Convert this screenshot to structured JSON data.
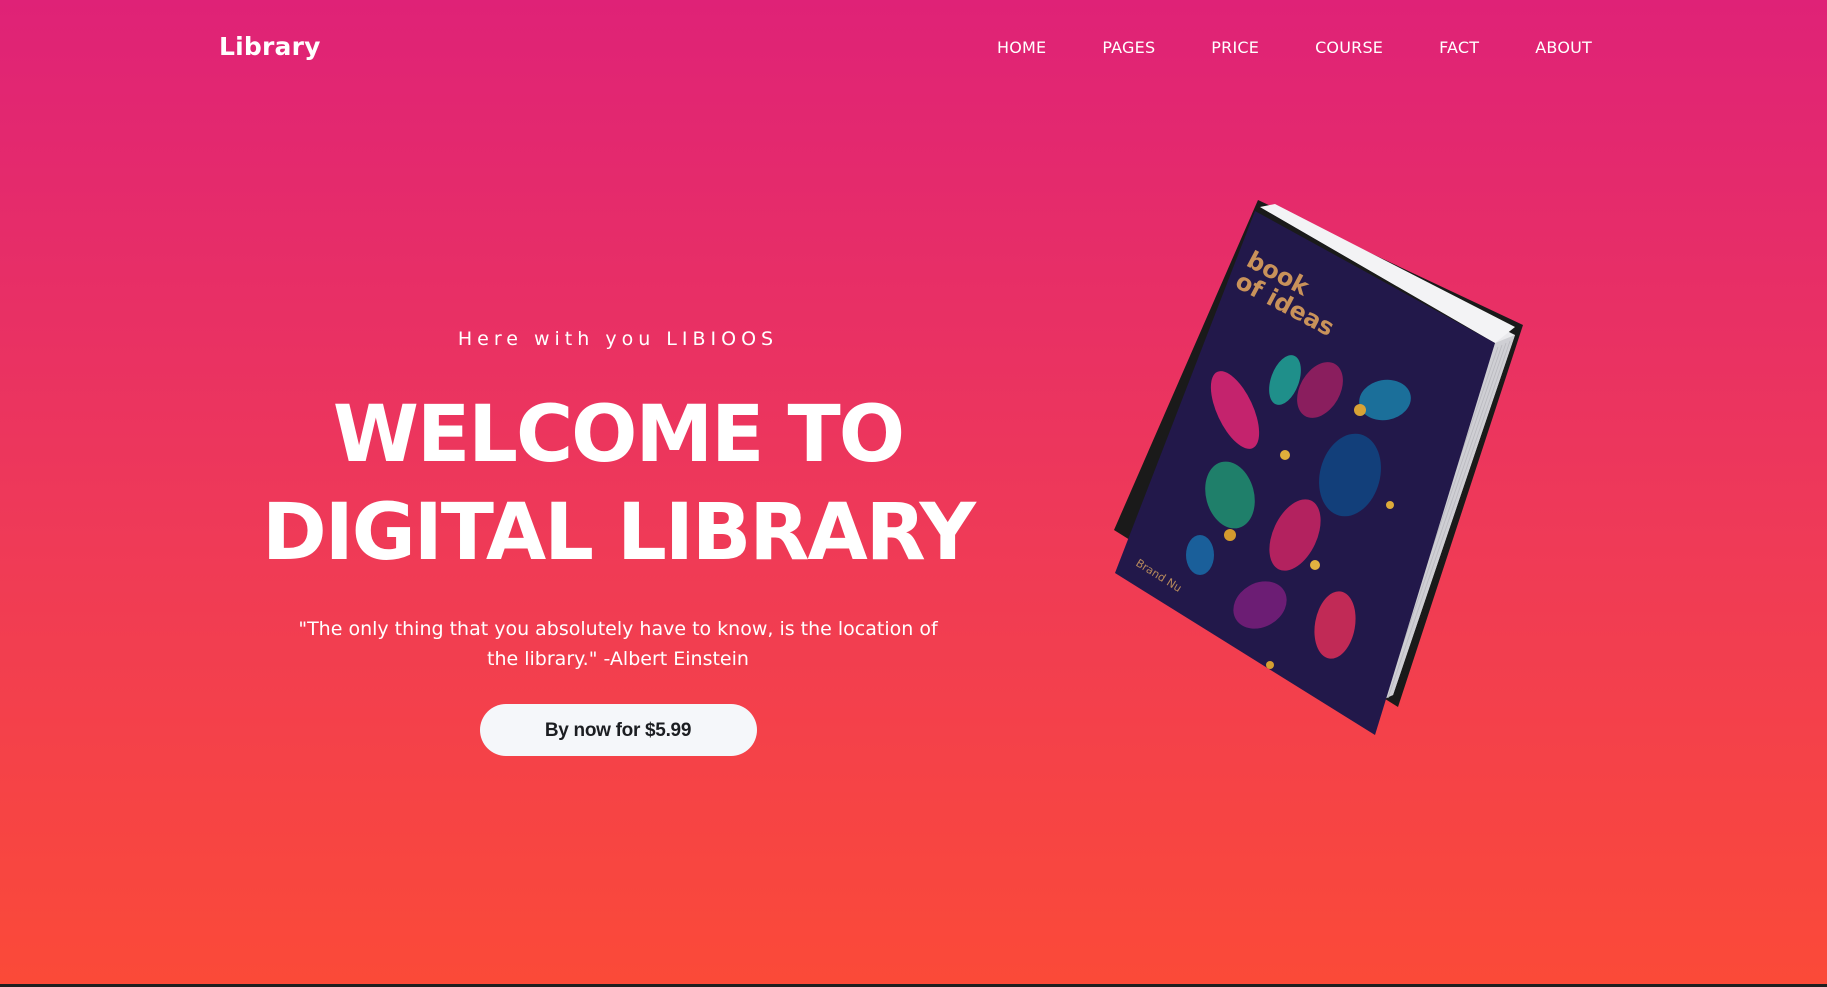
{
  "navbar": {
    "logo": "Library",
    "links": [
      "HOME",
      "PAGES",
      "PRICE",
      "COURSE",
      "FACT",
      "ABOUT"
    ]
  },
  "hero": {
    "eyebrow": "Here with you LIBIOOS",
    "headline_line1": "WELCOME TO",
    "headline_line2": "DIGITAL LIBRARY",
    "quote": "\"The only thing that you absolutely have to know, is the location of the library.\" -Albert Einstein",
    "cta_label": "By now for $5.99"
  },
  "book": {
    "title_line1": "book",
    "title_line2": "of ideas",
    "author": "Brand Nu"
  },
  "colors": {
    "gradient_top": "#df2277",
    "gradient_bottom": "#fb4a38",
    "button_bg": "#f5f7fa",
    "book_cover": "#22184a"
  }
}
